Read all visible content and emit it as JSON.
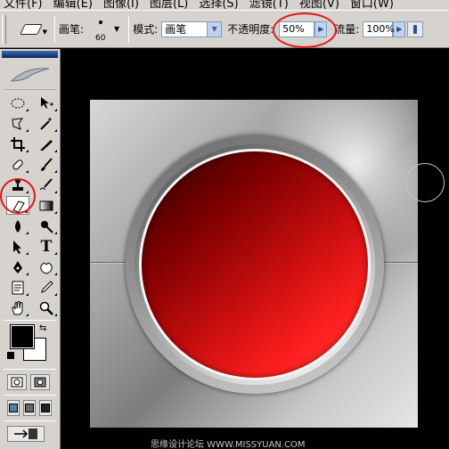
{
  "menu": {
    "items": [
      "文件(F)",
      "编辑(E)",
      "图像(I)",
      "图层(L)",
      "选择(S)",
      "滤镜(T)",
      "视图(V)",
      "窗口(W)"
    ]
  },
  "options": {
    "tool_icon": "eraser-icon",
    "brush_label": "画笔:",
    "brush_size": "60",
    "mode_label": "模式:",
    "mode_value": "画笔",
    "opacity_label": "不透明度:",
    "opacity_value": "50%",
    "flow_label": "流量:",
    "flow_value": "100%"
  },
  "toolbox": {
    "tools": [
      "marquee-icon",
      "move-icon",
      "lasso-icon",
      "magic-wand-icon",
      "crop-icon",
      "slice-icon",
      "healing-brush-icon",
      "brush-icon",
      "clone-stamp-icon",
      "history-brush-icon",
      "eraser-icon",
      "gradient-icon",
      "blur-icon",
      "dodge-icon",
      "path-selection-icon",
      "type-icon",
      "pen-icon",
      "custom-shape-icon",
      "notes-icon",
      "eyedropper-icon",
      "hand-icon",
      "zoom-icon"
    ],
    "selected_tool": "eraser-icon",
    "type_glyph": "T",
    "foreground_color": "#000000",
    "background_color": "#ffffff"
  },
  "annotations": {
    "highlight_color": "#e01818"
  },
  "canvas": {
    "button_color": "#e01010",
    "watermark": "思缘设计论坛 WWW.MISSYUAN.COM"
  }
}
